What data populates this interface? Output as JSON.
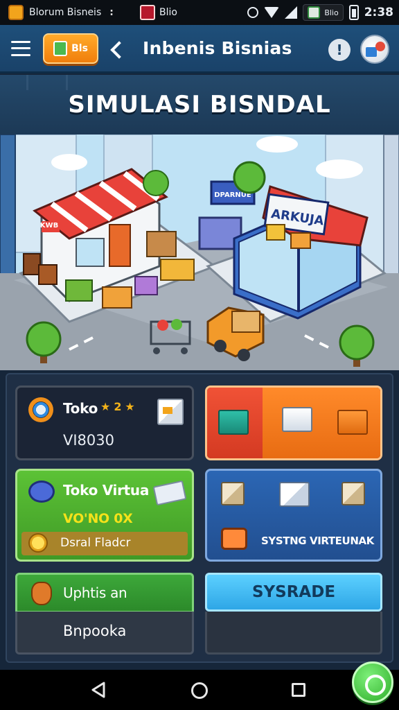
{
  "status_bar": {
    "app_name": "Blorum Bisneis",
    "menu_dots": ":",
    "item": "Blio",
    "notification": "Blio",
    "time": "2:38"
  },
  "app_bar": {
    "chip_label": "Bls",
    "title": "Inbenis Bisnias",
    "info": "!"
  },
  "banner": {
    "title": "SIMULASI BISNDAL"
  },
  "scene": {
    "shop_sign_left": "KWB",
    "shop_sign_right": "ARKUJA",
    "sign_board": "DPARNUE"
  },
  "cards": {
    "toko": {
      "title": "Toko",
      "stars": "★ 2 ★",
      "value": "VI8030"
    },
    "toko_virtua": {
      "title": "Toko Virtua",
      "subtitle": "VO'NO 0X",
      "bar_label": "Dsral Fladcr"
    },
    "systems": {
      "label": "SYSTNG VIRTEUNAK"
    },
    "update": {
      "title": "Uphtis an",
      "subtitle": "Bnpooka"
    },
    "sysrade": {
      "label": "SYSRADE"
    }
  },
  "colors": {
    "appbar": "#1e4f7a",
    "orange_card_left": "#e8422a",
    "orange_card_right": "#f27a1a",
    "green_card": "#4fb22f",
    "blue_card": "#2a5ea6",
    "sysrade_button": "#3db9f2"
  }
}
